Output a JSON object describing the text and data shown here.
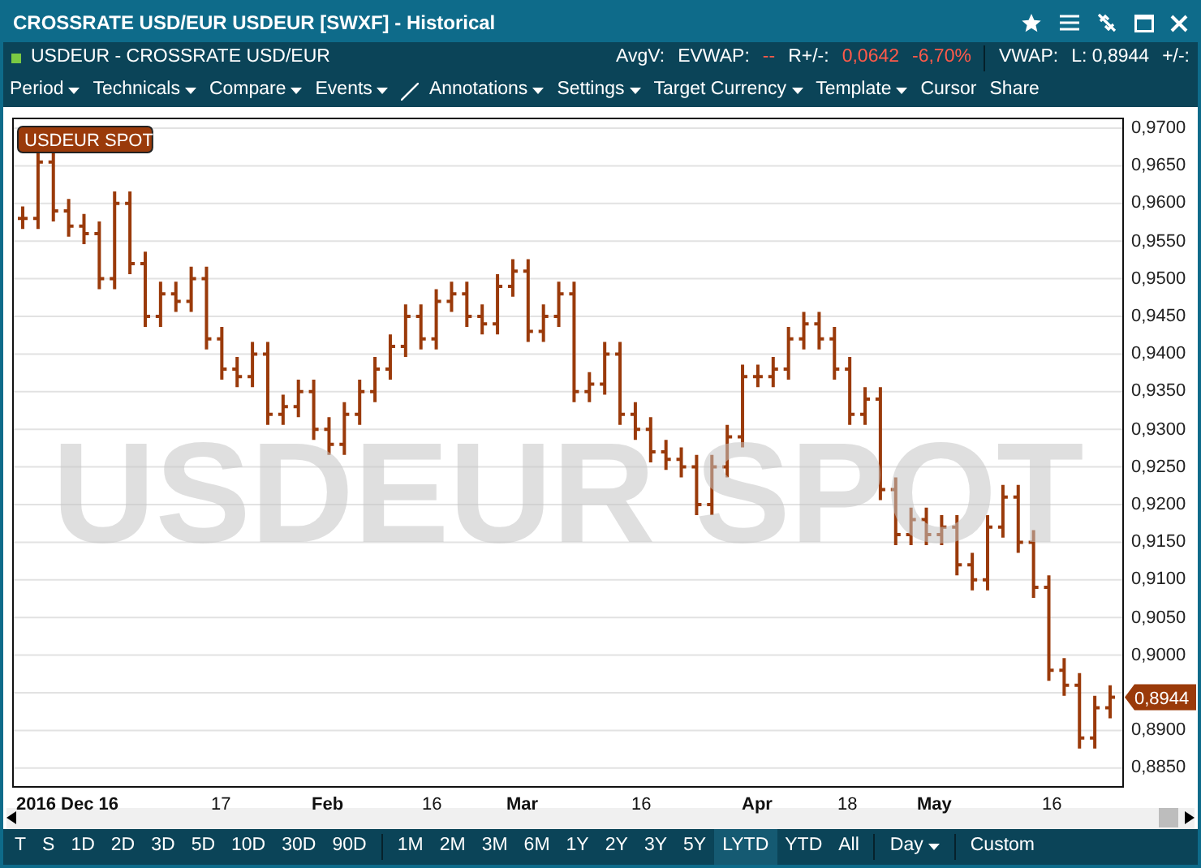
{
  "window": {
    "title": "CROSSRATE USD/EUR USDEUR [SWXF] - Historical"
  },
  "info_bar": {
    "instrument": "USDEUR - CROSSRATE USD/EUR",
    "stats": [
      {
        "text": "AvgV:",
        "kind": "label"
      },
      {
        "text": "EVWAP:",
        "kind": "label"
      },
      {
        "text": "--",
        "kind": "negative"
      },
      {
        "text": "R+/-:",
        "kind": "label"
      },
      {
        "text": "0,0642",
        "kind": "negative"
      },
      {
        "text": "-6,70%",
        "kind": "negative"
      },
      {
        "text": "VWAP:",
        "kind": "label",
        "divider": true
      },
      {
        "text": "L: 0,8944",
        "kind": "label"
      },
      {
        "text": "+/-:",
        "kind": "label"
      }
    ]
  },
  "menu": [
    {
      "label": "Period",
      "dropdown": true,
      "kind": "menu"
    },
    {
      "label": "Technicals",
      "dropdown": true,
      "kind": "menu"
    },
    {
      "label": "Compare",
      "dropdown": true,
      "kind": "menu"
    },
    {
      "label": "Events",
      "dropdown": true,
      "kind": "menu"
    },
    {
      "label": "Annotations",
      "dropdown": true,
      "kind": "pen"
    },
    {
      "label": "Settings",
      "dropdown": true,
      "kind": "menu"
    },
    {
      "label": "Target Currency",
      "dropdown": true,
      "kind": "menu"
    },
    {
      "label": "Template",
      "dropdown": true,
      "kind": "menu"
    },
    {
      "label": "Cursor",
      "dropdown": false,
      "kind": "menu"
    },
    {
      "label": "Share",
      "dropdown": false,
      "kind": "menu"
    }
  ],
  "chart": {
    "legend": "USDEUR SPOT",
    "watermark": "USDEUR SPOT",
    "last_value": "0,8944",
    "y_axis_upper": [
      "0,9700",
      "0,9650",
      "0,9600",
      "0,9550",
      "0,9500",
      "0,9450",
      "0,9400",
      "0,9350",
      "0,9300",
      "0,9250",
      "0,9200",
      "0,9150",
      "0,9100",
      "0,9050",
      "0,9000"
    ],
    "y_axis_lower": [
      "0,8900",
      "0,8850"
    ],
    "x_axis": [
      {
        "label": "2016 Dec 16",
        "kind": "month"
      },
      {
        "label": "17",
        "kind": "day"
      },
      {
        "label": "Feb",
        "kind": "month"
      },
      {
        "label": "16",
        "kind": "day"
      },
      {
        "label": "Mar",
        "kind": "month"
      },
      {
        "label": "16",
        "kind": "day"
      },
      {
        "label": "Apr",
        "kind": "month"
      },
      {
        "label": "18",
        "kind": "day"
      },
      {
        "label": "May",
        "kind": "month"
      },
      {
        "label": "16",
        "kind": "day"
      }
    ]
  },
  "range_bar": {
    "groups": [
      [
        {
          "label": "T",
          "selected": false
        },
        {
          "label": "S",
          "selected": false
        },
        {
          "label": "1D",
          "selected": false
        },
        {
          "label": "2D",
          "selected": false
        },
        {
          "label": "3D",
          "selected": false
        },
        {
          "label": "5D",
          "selected": false
        },
        {
          "label": "10D",
          "selected": false
        },
        {
          "label": "30D",
          "selected": false
        },
        {
          "label": "90D",
          "selected": false
        }
      ],
      [
        {
          "label": "1M",
          "selected": false
        },
        {
          "label": "2M",
          "selected": false
        },
        {
          "label": "3M",
          "selected": false
        },
        {
          "label": "6M",
          "selected": false
        },
        {
          "label": "1Y",
          "selected": false
        },
        {
          "label": "2Y",
          "selected": false
        },
        {
          "label": "3Y",
          "selected": false
        },
        {
          "label": "5Y",
          "selected": false
        },
        {
          "label": "LYTD",
          "selected": true
        },
        {
          "label": "YTD",
          "selected": false
        },
        {
          "label": "All",
          "selected": false
        }
      ],
      [
        {
          "label": "Day",
          "selected": false,
          "dropdown": true
        }
      ],
      [
        {
          "label": "Custom",
          "selected": false
        }
      ]
    ]
  }
}
